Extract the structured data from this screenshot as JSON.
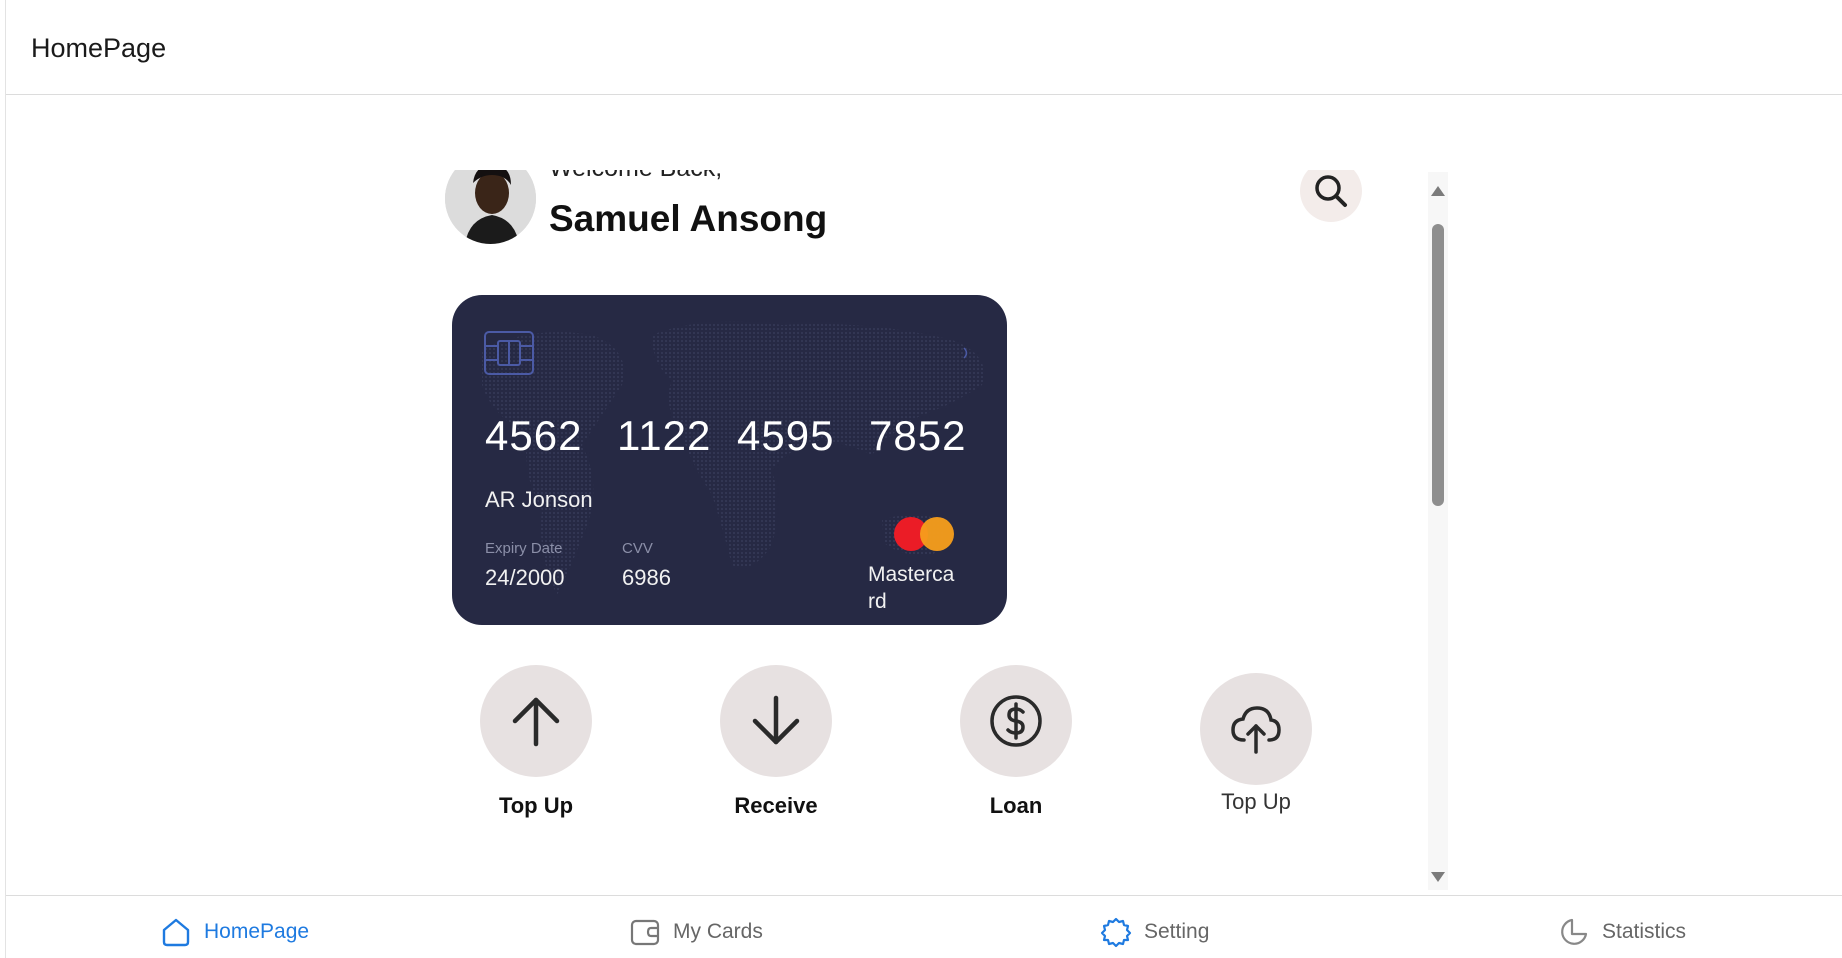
{
  "header": {
    "title": "HomePage"
  },
  "welcome": {
    "greeting": "Welcome Back,",
    "name": "Samuel Ansong"
  },
  "card": {
    "number_groups": [
      "4562",
      "1122",
      "4595",
      "7852"
    ],
    "holder": "AR Jonson",
    "expiry_label": "Expiry Date",
    "expiry": "24/2000",
    "cvv_label": "CVV",
    "cvv": "6986",
    "brand": "Mastercard",
    "colors": {
      "card_bg": "#262944",
      "mc_red": "#eb1c26",
      "mc_orange": "#f79e1b"
    }
  },
  "actions": [
    {
      "label": "Top Up",
      "icon": "arrow-up-icon"
    },
    {
      "label": "Receive",
      "icon": "arrow-down-icon"
    },
    {
      "label": "Loan",
      "icon": "dollar-circle-icon"
    },
    {
      "label": "Top Up",
      "icon": "cloud-upload-icon"
    }
  ],
  "bottom_nav": [
    {
      "label": "HomePage",
      "icon": "home-icon",
      "active": true
    },
    {
      "label": "My Cards",
      "icon": "wallet-icon",
      "active": false
    },
    {
      "label": "Setting",
      "icon": "settings-icon",
      "active": false
    },
    {
      "label": "Statistics",
      "icon": "pie-chart-icon",
      "active": false
    }
  ],
  "theme": {
    "accent": "#1e7ae0",
    "action_circle": "#e7e1e1"
  }
}
